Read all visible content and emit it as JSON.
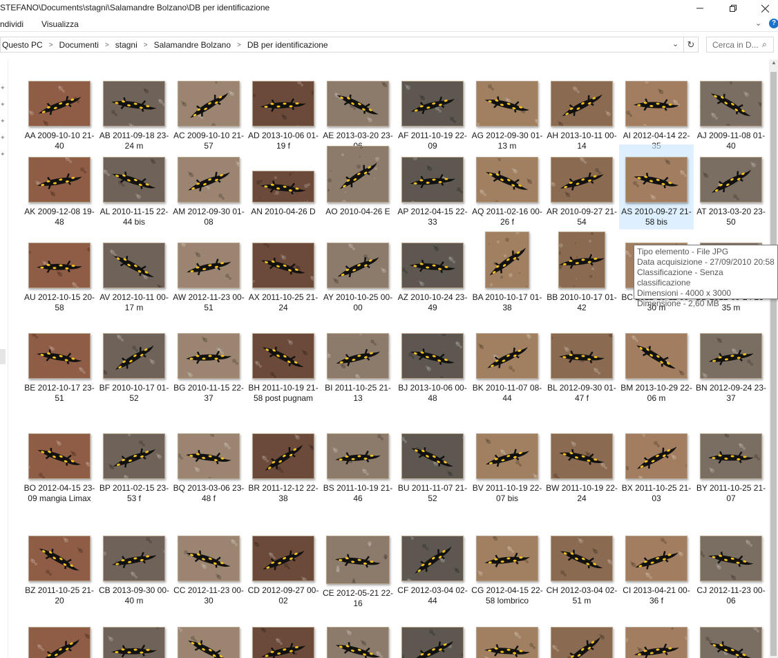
{
  "window": {
    "title": "STEFANO\\Documents\\stagni\\Salamandre Bolzano\\DB per identificazione",
    "controls": [
      "minimize-icon",
      "restore-icon",
      "close-icon"
    ]
  },
  "ribbon": {
    "tabs": [
      "ndividi",
      "Visualizza"
    ],
    "expand_icon": "chevron-down-icon",
    "help_icon": "help-icon"
  },
  "address": {
    "crumbs": [
      "Questo PC",
      "Documenti",
      "stagni",
      "Salamandre Bolzano",
      "DB per identificazione"
    ],
    "dropdown_icon": "chevron-down-icon",
    "refresh_icon": "refresh-icon"
  },
  "search": {
    "placeholder": "Cerca in D..."
  },
  "files": [
    {
      "label": "AA 2009-10-10 21-40"
    },
    {
      "label": "AB 2011-09-18 23-24 m"
    },
    {
      "label": "AC 2009-10-10 21-57"
    },
    {
      "label": "AD 2013-10-06 01-19 f"
    },
    {
      "label": "AE 2013-03-20 23-06"
    },
    {
      "label": "AF 2011-10-19 22-09"
    },
    {
      "label": "AG 2012-09-30 01-13 m"
    },
    {
      "label": "AH 2013-10-11 00-14"
    },
    {
      "label": "AI 2012-04-14 22-35"
    },
    {
      "label": "AJ 2009-11-08 01-40"
    },
    {
      "label": "AK 2009-12-08 19-48"
    },
    {
      "label": "AL 2010-11-15 22-44 bis"
    },
    {
      "label": "AM 2012-09-30 01-08"
    },
    {
      "label": "AN 2010-04-26 D"
    },
    {
      "label": "AO 2010-04-26 E"
    },
    {
      "label": "AP 2012-04-15 22-33"
    },
    {
      "label": "AQ 2011-02-16 00-26 f"
    },
    {
      "label": "AR 2010-09-27 21-54"
    },
    {
      "label": "AS 2010-09-27 21-58 bis"
    },
    {
      "label": "AT 2013-03-20 23-50"
    },
    {
      "label": "AU 2012-10-15 20-58"
    },
    {
      "label": "AV 2012-10-11 00-17 m"
    },
    {
      "label": "AW 2012-11-23 00-51"
    },
    {
      "label": "AX 2011-10-25 21-24"
    },
    {
      "label": "AY 2010-10-25 00-00"
    },
    {
      "label": "AZ 2010-10-24 23-49"
    },
    {
      "label": "BA 2010-10-17 01-38"
    },
    {
      "label": "BB 2010-10-17 01-42"
    },
    {
      "label": "BC 2012-10-11 00-30 m"
    },
    {
      "label": "BD 2012-09-24 23-35 m"
    },
    {
      "label": "BE 2012-10-17 23-51"
    },
    {
      "label": "BF 2010-10-17 01-52"
    },
    {
      "label": "BG 2010-11-15 22-37"
    },
    {
      "label": "BH 2011-10-19 21-58 post pugnam"
    },
    {
      "label": "BI 2011-10-25 21-13"
    },
    {
      "label": "BJ 2013-10-06 00-48"
    },
    {
      "label": "BK 2010-11-07 08-44"
    },
    {
      "label": "BL 2012-09-30 01-47 f"
    },
    {
      "label": "BM 2013-10-29 22-06 m"
    },
    {
      "label": "BN 2012-09-24 23-37"
    },
    {
      "label": "BO 2012-04-15 23-09 mangia Limax"
    },
    {
      "label": "BP 2011-02-15 23-53 f"
    },
    {
      "label": "BQ 2013-03-06 23-48 f"
    },
    {
      "label": "BR 2011-12-12 22-38"
    },
    {
      "label": "BS 2011-10-19 21-46"
    },
    {
      "label": "BU 2011-11-07 21-52"
    },
    {
      "label": "BV 2011-10-19 22-07 bis"
    },
    {
      "label": "BW 2011-10-19 22-24"
    },
    {
      "label": "BX 2011-10-25 21-03"
    },
    {
      "label": "BY 2011-10-25 21-07"
    },
    {
      "label": "BZ 2011-10-25 21-20"
    },
    {
      "label": "CB 2013-09-30 00-40 m"
    },
    {
      "label": "CC 2012-11-23 00-30"
    },
    {
      "label": "CD 2012-09-27 00-02"
    },
    {
      "label": "CE 2012-05-21 22-16"
    },
    {
      "label": "CF 2012-03-04 02-44"
    },
    {
      "label": "CG 2012-04-15 22-58 lombrico"
    },
    {
      "label": "CH 2012-03-04 02-51 m"
    },
    {
      "label": "CI 2013-04-21 00-36 f"
    },
    {
      "label": "CJ 2012-11-23 00-06"
    },
    {
      "label": ""
    },
    {
      "label": ""
    },
    {
      "label": ""
    },
    {
      "label": ""
    },
    {
      "label": ""
    },
    {
      "label": ""
    },
    {
      "label": ""
    },
    {
      "label": ""
    },
    {
      "label": ""
    },
    {
      "label": ""
    }
  ],
  "selected_file": "AS 2010-09-27 21-58 bis",
  "tooltip": {
    "lines": [
      "Tipo elemento - File JPG",
      "Data acquisizione - 27/09/2010 20:58",
      "Classificazione - Senza classificazione",
      "Dimensioni - 4000 x 3000",
      "Dimensione - 2,60 MB"
    ]
  },
  "colors": {
    "selection": "#cce8ff",
    "accent": "#1a73c9",
    "salamander_body": "#111111",
    "salamander_spots": "#f2c21b"
  }
}
